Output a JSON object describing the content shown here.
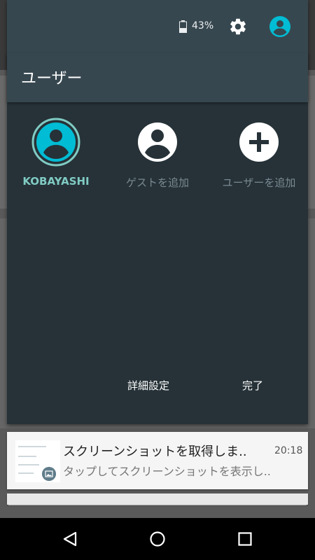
{
  "status": {
    "battery_pct": "43%",
    "battery_level": 0.43
  },
  "panel": {
    "title": "ユーザー",
    "users": [
      {
        "label": "KOBAYASHI",
        "icon": "user-avatar-icon",
        "active": true
      },
      {
        "label": "ゲストを追加",
        "icon": "guest-avatar-icon",
        "active": false
      },
      {
        "label": "ユーザーを追加",
        "icon": "add-user-icon",
        "active": false
      }
    ],
    "more_settings_label": "詳細設定",
    "done_label": "完了"
  },
  "notification": {
    "title": "スクリーンショットを取得しま..",
    "time": "20:18",
    "text": "タップしてスクリーンショットを表示し.."
  },
  "colors": {
    "accent": "#00bcd4",
    "panel_bg": "#263238",
    "header_bg": "#37474f",
    "active_label": "#80cbc4"
  },
  "icons": {
    "status_battery": "battery-icon",
    "status_settings": "gear-icon",
    "status_user": "user-icon",
    "nav_back": "back-triangle-icon",
    "nav_home": "home-circle-icon",
    "nav_recent": "recents-square-icon"
  }
}
